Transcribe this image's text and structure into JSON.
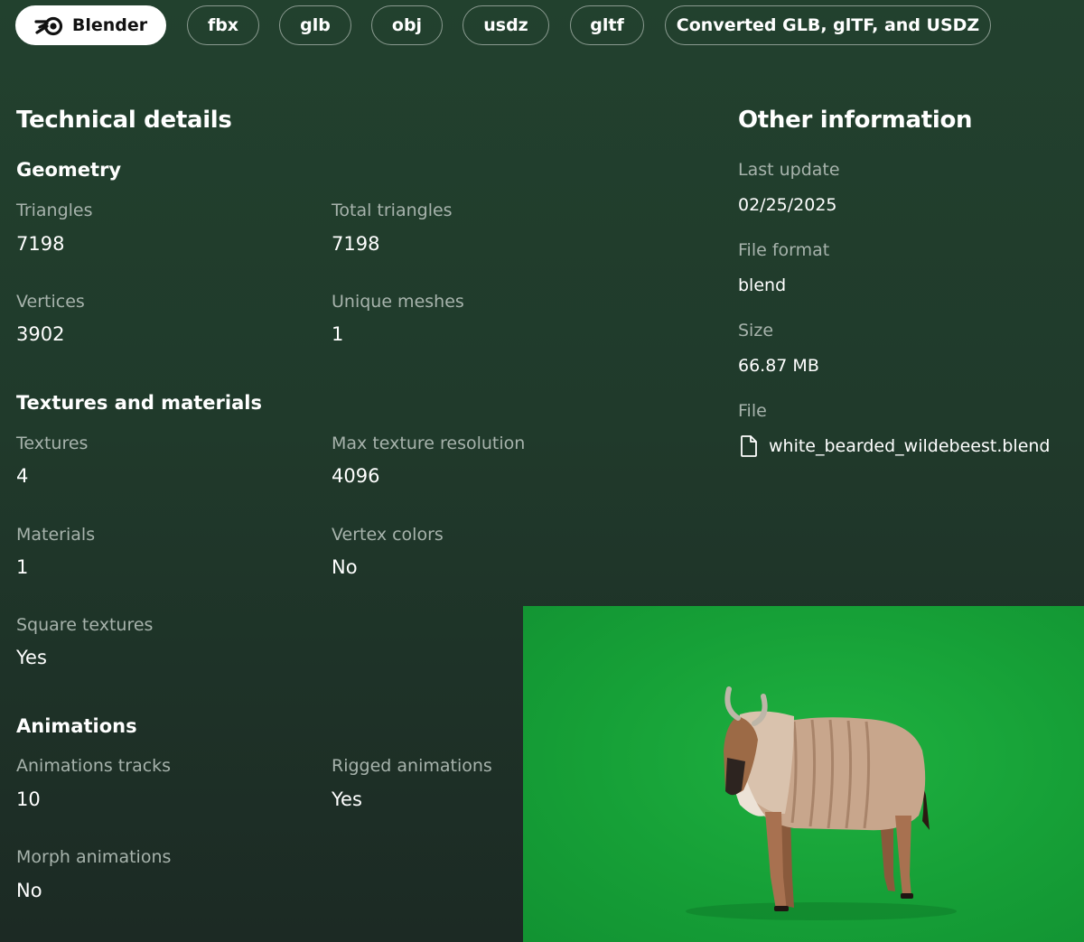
{
  "formats": {
    "blender": "Blender",
    "fbx": "fbx",
    "glb": "glb",
    "obj": "obj",
    "usdz": "usdz",
    "gltf": "gltf",
    "converted": "Converted GLB, glTF, and USDZ"
  },
  "technical": {
    "title": "Technical details",
    "geometry": {
      "title": "Geometry",
      "triangles_label": "Triangles",
      "triangles": "7198",
      "total_triangles_label": "Total triangles",
      "total_triangles": "7198",
      "vertices_label": "Vertices",
      "vertices": "3902",
      "unique_meshes_label": "Unique meshes",
      "unique_meshes": "1"
    },
    "textures": {
      "title": "Textures and materials",
      "textures_label": "Textures",
      "textures": "4",
      "max_res_label": "Max texture resolution",
      "max_res": "4096",
      "materials_label": "Materials",
      "materials": "1",
      "vertex_colors_label": "Vertex colors",
      "vertex_colors": "No",
      "square_label": "Square textures",
      "square": "Yes"
    },
    "animations": {
      "title": "Animations",
      "tracks_label": "Animations tracks",
      "tracks": "10",
      "rigged_label": "Rigged animations",
      "rigged": "Yes",
      "morph_label": "Morph animations",
      "morph": "No"
    }
  },
  "other": {
    "title": "Other information",
    "last_update_label": "Last update",
    "last_update": "02/25/2025",
    "file_format_label": "File format",
    "file_format": "blend",
    "size_label": "Size",
    "size": "66.87 MB",
    "file_label": "File",
    "file_name": "white_bearded_wildebeest.blend"
  },
  "icons": {
    "blender": "blender-logo-icon",
    "file": "file-icon"
  },
  "colors": {
    "background": "#21392b",
    "label": "#a7b3ac",
    "preview_green": "#17a238"
  }
}
